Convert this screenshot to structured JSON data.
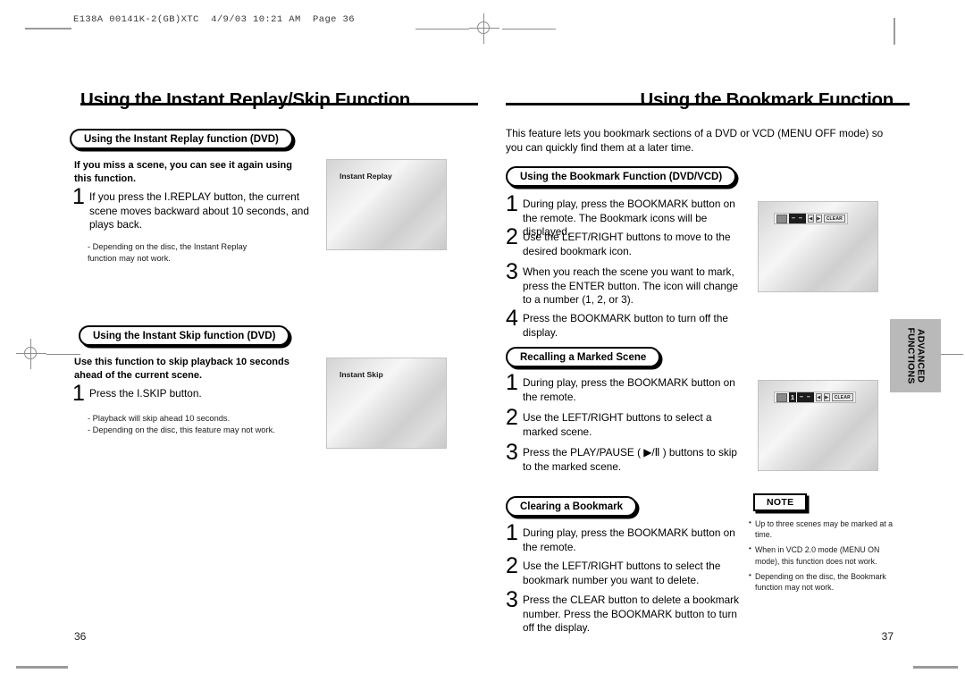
{
  "scan": {
    "header": "E138A 00141K-2(GB)XTC  4/9/03 10:21 AM  Page 36"
  },
  "left_page": {
    "title": "Using the Instant Replay/Skip Function",
    "page_number": "36",
    "sections": [
      {
        "badge": "Using the Instant Replay function (DVD)",
        "lead": "If you miss a scene, you can see it again using this function.",
        "steps": [
          {
            "num": "1",
            "text": "If you press the I.REPLAY button, the current scene moves backward about 10 seconds, and plays back."
          }
        ],
        "footnotes": [
          "- Depending on the disc, the Instant Replay",
          "  function may not work."
        ],
        "screen_label": "Instant Replay"
      },
      {
        "badge": "Using the Instant Skip function (DVD)",
        "lead": "Use this function to skip playback 10 seconds ahead of the current scene.",
        "steps": [
          {
            "num": "1",
            "text": "Press the I.SKIP button."
          }
        ],
        "footnotes": [
          "- Playback will skip ahead 10 seconds.",
          "- Depending on the disc, this feature may not work."
        ],
        "screen_label": "Instant Skip"
      }
    ]
  },
  "right_page": {
    "title": "Using the Bookmark Function",
    "page_number": "37",
    "intro": "This feature lets you bookmark sections of a DVD or VCD (MENU OFF mode) so you can quickly find them at a later time.",
    "sections": [
      {
        "badge": "Using the Bookmark Function (DVD/VCD)",
        "steps": [
          {
            "num": "1",
            "text": "During play, press the BOOKMARK button on the remote. The Bookmark icons will be displayed."
          },
          {
            "num": "2",
            "text": "Use the LEFT/RIGHT buttons to move to the desired bookmark icon."
          },
          {
            "num": "3",
            "text": "When you reach the scene you want to mark, press the ENTER button. The icon will change to a number (1, 2, or 3)."
          },
          {
            "num": "4",
            "text": "Press the BOOKMARK button to turn off the display."
          }
        ]
      },
      {
        "badge": "Recalling a Marked Scene",
        "steps": [
          {
            "num": "1",
            "text": "During play, press the BOOKMARK button on the remote."
          },
          {
            "num": "2",
            "text": "Use the LEFT/RIGHT buttons to select a marked scene."
          },
          {
            "num": "3",
            "text": "Press the PLAY/PAUSE ( ▶/Ⅱ ) buttons to skip to the marked scene."
          }
        ]
      },
      {
        "badge": "Clearing a Bookmark",
        "steps": [
          {
            "num": "1",
            "text": "During play, press the BOOKMARK button on the remote."
          },
          {
            "num": "2",
            "text": "Use the LEFT/RIGHT buttons to select the bookmark number you want to delete."
          },
          {
            "num": "3",
            "text": "Press the CLEAR button to delete a bookmark number. Press the BOOKMARK button to turn off the display."
          }
        ]
      }
    ],
    "screens": [
      {
        "osd": {
          "icon": "bookmark-icon",
          "number": "",
          "dashes": "–  –",
          "buttons": [
            "◀",
            "▶"
          ],
          "clear_label": "CLEAR"
        }
      },
      {
        "osd": {
          "icon": "bookmark-icon",
          "number": "1",
          "dashes": "–  –",
          "buttons": [
            "◀",
            "▶"
          ],
          "clear_label": "CLEAR"
        }
      }
    ],
    "note": {
      "badge": "NOTE",
      "items": [
        "Up to three scenes may be marked at a time.",
        "When in VCD 2.0 mode (MENU ON mode), this function does not work.",
        "Depending on the disc, the Bookmark function may not work."
      ]
    },
    "side_tab": "ADVANCED\nFUNCTIONS"
  }
}
